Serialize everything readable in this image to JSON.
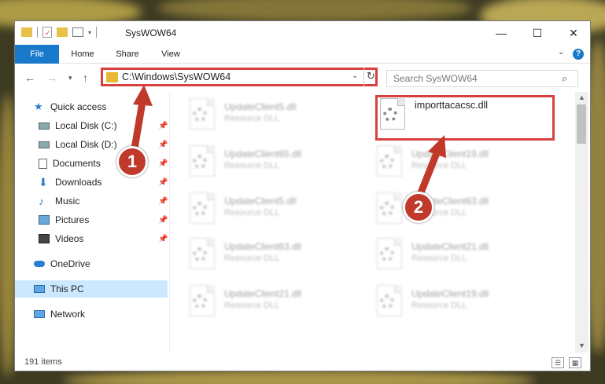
{
  "window": {
    "title": "SysWOW64"
  },
  "ribbon": {
    "tabs": [
      "File",
      "Home",
      "Share",
      "View"
    ],
    "help_label": "?"
  },
  "address_bar": {
    "path": "C:\\Windows\\SysWOW64"
  },
  "search": {
    "placeholder": "Search SysWOW64"
  },
  "sidebar": {
    "quick_access": "Quick access",
    "items": [
      {
        "label": "Local Disk (C:)",
        "icon": "drive-icon",
        "pinned": true
      },
      {
        "label": "Local Disk (D:)",
        "icon": "drive-icon",
        "pinned": true
      },
      {
        "label": "Documents",
        "icon": "documents-icon",
        "pinned": true
      },
      {
        "label": "Downloads",
        "icon": "download-icon",
        "pinned": true
      },
      {
        "label": "Music",
        "icon": "music-icon",
        "pinned": true
      },
      {
        "label": "Pictures",
        "icon": "pictures-icon",
        "pinned": true
      },
      {
        "label": "Videos",
        "icon": "videos-icon",
        "pinned": true
      }
    ],
    "onedrive": "OneDrive",
    "this_pc": "This PC",
    "network": "Network"
  },
  "files": {
    "highlighted": {
      "name": "importtacacsc.dll"
    },
    "left_column": [
      {
        "name": "UpdateClient5.dll",
        "type": "Resource DLL"
      },
      {
        "name": "UpdateClient65.dll",
        "type": "Resource DLL"
      },
      {
        "name": "UpdateClient5.dll",
        "type": "Resource DLL"
      },
      {
        "name": "UpdateClient63.dll",
        "type": "Resource DLL"
      },
      {
        "name": "UpdateClient21.dll",
        "type": "Resource DLL"
      }
    ],
    "right_column": [
      {
        "name": "UpdateClient19.dll",
        "type": "Resource DLL"
      },
      {
        "name": "UpdateClient63.dll",
        "type": "Resource DLL"
      },
      {
        "name": "UpdateClient21.dll",
        "type": "Resource DLL"
      },
      {
        "name": "UpdateClient19.dll",
        "type": "Resource DLL"
      }
    ]
  },
  "status": {
    "count": "191 items"
  },
  "annotations": {
    "step1": "1",
    "step2": "2",
    "color": "#c0392b"
  }
}
